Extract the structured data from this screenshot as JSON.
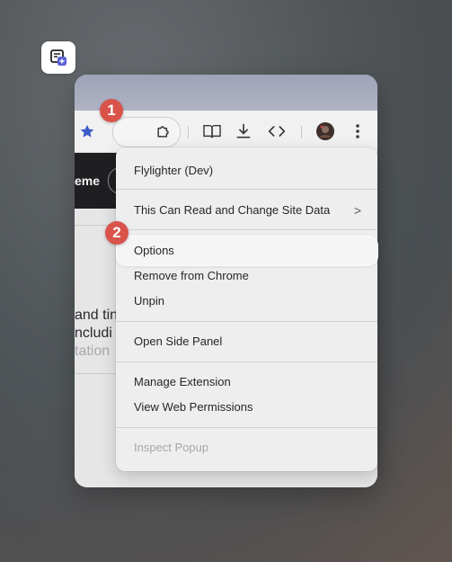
{
  "extension_name": "Flylighter (Dev)",
  "menu": {
    "site_data": "This Can Read and Change Site Data",
    "site_data_chevron": ">",
    "options": "Options",
    "remove": "Remove from Chrome",
    "unpin": "Unpin",
    "side_panel": "Open Side Panel",
    "manage": "Manage Extension",
    "permissions": "View Web Permissions",
    "inspect": "Inspect Popup"
  },
  "page": {
    "banner_text": "eme",
    "line1": "and tin",
    "line2": "ncludi",
    "line3": "tation"
  },
  "badges": {
    "step1": "1",
    "step2": "2"
  },
  "colors": {
    "badge": "#d9534a",
    "star": "#3b5bc7",
    "extension_icon_accent": "#5a62d6"
  },
  "icons": [
    "star-icon",
    "flylighter-extension-icon",
    "puzzle-extensions-icon",
    "reading-mode-icon",
    "download-icon",
    "code-icon",
    "profile-avatar",
    "more-menu-icon"
  ]
}
